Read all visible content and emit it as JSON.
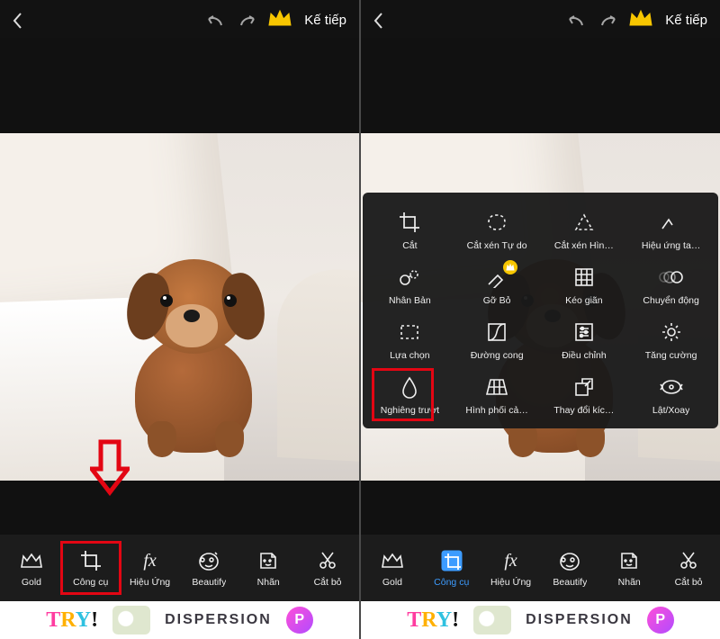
{
  "header": {
    "next_label": "Kế tiếp"
  },
  "nav": {
    "gold": "Gold",
    "tools": "Công cụ",
    "effects": "Hiệu Ứng",
    "beautify": "Beautify",
    "sticker": "Nhãn",
    "cutout": "Cắt bỏ"
  },
  "tools": {
    "crop": "Cắt",
    "free_crop": "Cắt xén Tự do",
    "shape_crop": "Cắt xén Hìn…",
    "disperse": "Hiệu ứng ta…",
    "clone": "Nhân Bản",
    "remove": "Gỡ Bỏ",
    "stretch": "Kéo giãn",
    "motion": "Chuyển động",
    "select": "Lựa chọn",
    "curves": "Đường cong",
    "adjust": "Điều chỉnh",
    "enhance": "Tăng cường",
    "tilt_shift": "Nghiêng trượt",
    "perspective": "Hình phối cả…",
    "resize": "Thay đổi kíc…",
    "flip": "Lật/Xoay"
  },
  "ad": {
    "try": "TRY!",
    "dispersion": "DISPERSION",
    "badge": "P"
  }
}
